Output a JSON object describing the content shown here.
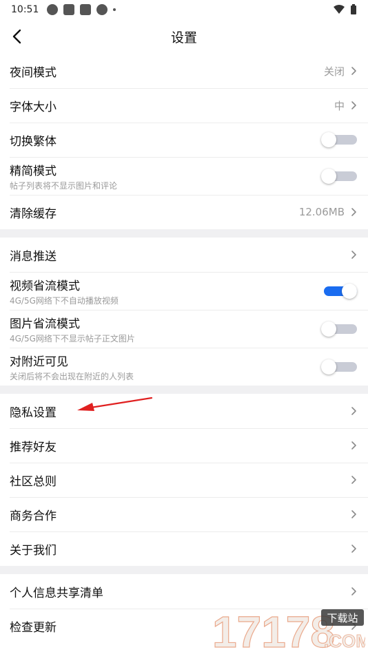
{
  "status_bar": {
    "time": "10:51"
  },
  "header": {
    "title": "设置"
  },
  "sections": [
    [
      {
        "label": "夜间模式",
        "value": "关闭"
      },
      {
        "label": "字体大小",
        "value": "中"
      },
      {
        "label": "切换繁体",
        "toggle": false
      },
      {
        "label": "精简模式",
        "sub": "帖子列表将不显示图片和评论",
        "toggle": false
      },
      {
        "label": "清除缓存",
        "value": "12.06MB"
      }
    ],
    [
      {
        "label": "消息推送"
      },
      {
        "label": "视频省流模式",
        "sub": "4G/5G网络下不自动播放视频",
        "toggle": true
      },
      {
        "label": "图片省流模式",
        "sub": "4G/5G网络下不显示帖子正文图片",
        "toggle": false
      },
      {
        "label": "对附近可见",
        "sub": "关闭后将不会出现在附近的人列表",
        "toggle": false
      }
    ],
    [
      {
        "label": "隐私设置"
      },
      {
        "label": "推荐好友"
      },
      {
        "label": "社区总则"
      },
      {
        "label": "商务合作"
      },
      {
        "label": "关于我们"
      }
    ],
    [
      {
        "label": "个人信息共享清单"
      },
      {
        "label": "检查更新"
      }
    ]
  ],
  "watermark": {
    "number": "17178",
    "badge": "下载站",
    "domain": ".COM"
  },
  "colors": {
    "accent": "#1a6cf0",
    "annotation_arrow": "#e02020"
  }
}
